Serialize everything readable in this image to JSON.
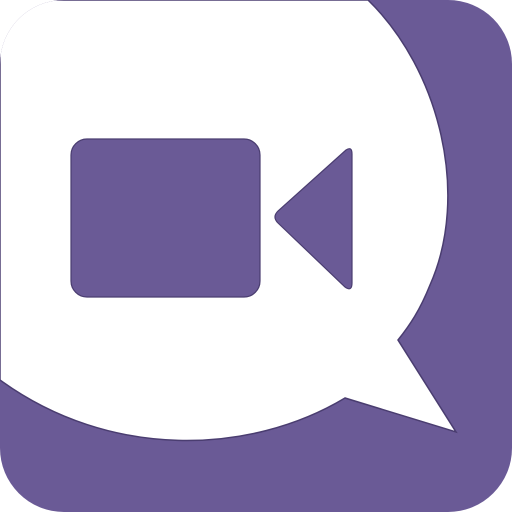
{
  "icon": {
    "name": "video-chat-app-icon",
    "glyph": "video-camera-in-speech-bubble",
    "colors": {
      "tile": "#6A5A96",
      "bubble": "#FFFFFF",
      "glyph": "#6A5A96",
      "outline": "#4A3D70"
    }
  }
}
